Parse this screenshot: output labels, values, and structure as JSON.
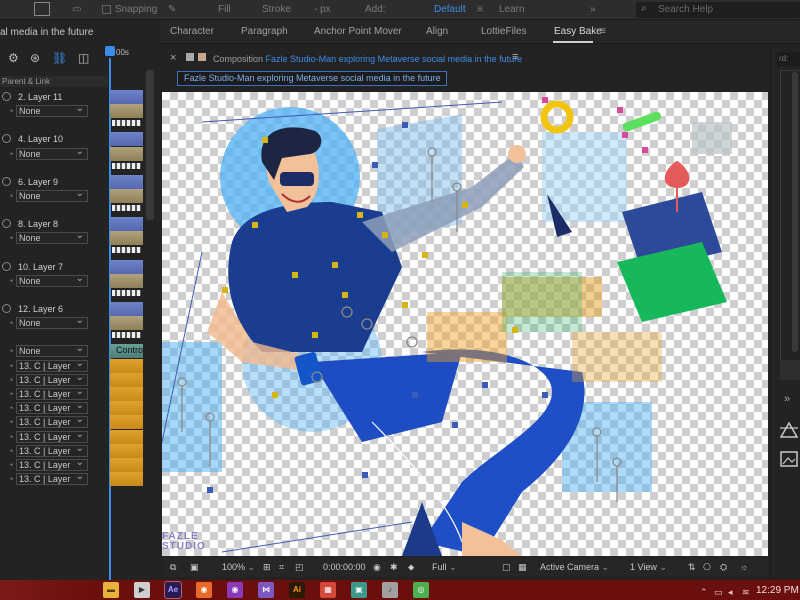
{
  "toolbar": {
    "snapping": "Snapping",
    "fill": "Fill",
    "stroke": "Stroke",
    "stroke_unit": "- px",
    "add": "Add:",
    "workspace_default": "Default",
    "workspace_learn": "Learn",
    "search_placeholder": "Search Help"
  },
  "tabs": [
    {
      "label": "Character"
    },
    {
      "label": "Paragraph"
    },
    {
      "label": "Anchor Point Mover"
    },
    {
      "label": "Align"
    },
    {
      "label": "LottieFiles"
    },
    {
      "label": "Easy Bake"
    }
  ],
  "timeline": {
    "title": "al media in the future",
    "time_marker": "00s",
    "column_header": "Parent & Link",
    "rows": [
      {
        "type": "name",
        "label": "2. Layer 11"
      },
      {
        "type": "parent",
        "label": "None"
      },
      {
        "type": "name",
        "label": "4. Layer 10"
      },
      {
        "type": "parent",
        "label": "None"
      },
      {
        "type": "name",
        "label": "6. Layer 9"
      },
      {
        "type": "parent",
        "label": "None"
      },
      {
        "type": "name",
        "label": "8. Layer 8"
      },
      {
        "type": "parent",
        "label": "None"
      },
      {
        "type": "name",
        "label": "10. Layer 7"
      },
      {
        "type": "parent",
        "label": "None"
      },
      {
        "type": "name",
        "label": "12. Layer 6"
      },
      {
        "type": "parent",
        "label": "None"
      },
      {
        "type": "parent",
        "label": "None"
      },
      {
        "type": "parent",
        "label": "13. C | Layer"
      },
      {
        "type": "parent",
        "label": "13. C | Layer"
      },
      {
        "type": "parent",
        "label": "13. C | Layer"
      },
      {
        "type": "parent",
        "label": "13. C | Layer"
      },
      {
        "type": "parent",
        "label": "13. C | Layer"
      },
      {
        "type": "parent",
        "label": "13. C | Layer"
      },
      {
        "type": "parent",
        "label": "13. C | Layer"
      },
      {
        "type": "parent",
        "label": "13. C | Layer"
      },
      {
        "type": "parent",
        "label": "13. C | Layer"
      }
    ],
    "control_track_label": "Contro"
  },
  "composition": {
    "prefix": "Composition",
    "name": "Fazle Studio-Man exploring Metaverse social media in the future",
    "breadcrumb": "Fazle Studio-Man exploring Metaverse social media in the future",
    "watermark": "FAZLE STUDIO"
  },
  "comp_footer": {
    "zoom": "100%",
    "timecode": "0:00:00:00",
    "resolution": "Full",
    "camera": "Active Camera",
    "views": "1 View"
  },
  "right_panel": {
    "search_text": "rd:"
  },
  "taskbar": {
    "clock": "12:29 PM",
    "apps": [
      {
        "name": "File Explorer"
      },
      {
        "name": "Clapper"
      },
      {
        "name": "After Effects"
      },
      {
        "name": "Firefox"
      },
      {
        "name": "Firefox Private"
      },
      {
        "name": "Visual Studio"
      },
      {
        "name": "Illustrator"
      },
      {
        "name": "Tiles"
      },
      {
        "name": "Image Viewer"
      },
      {
        "name": "Audio"
      },
      {
        "name": "Chrome"
      }
    ]
  },
  "colors": {
    "accent_blue": "#3b8ee8",
    "taskbar": "#6b0e0e",
    "track_orange": "#e1a12e",
    "track_blue": "#6f83c9"
  }
}
